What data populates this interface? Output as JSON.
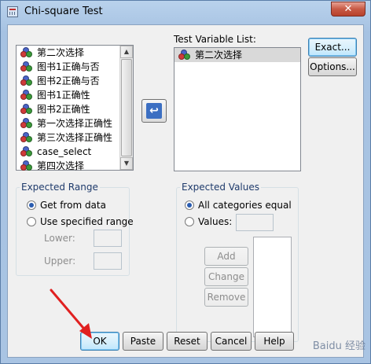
{
  "window": {
    "title": "Chi-square Test",
    "close_glyph": "✕"
  },
  "source_list": {
    "items": [
      {
        "label": "第二次选择",
        "icon": "nominal-variable-icon"
      },
      {
        "label": "图书1正确与否",
        "icon": "nominal-variable-icon"
      },
      {
        "label": "图书2正确与否",
        "icon": "nominal-variable-icon"
      },
      {
        "label": "图书1正确性",
        "icon": "nominal-variable-icon"
      },
      {
        "label": "图书2正确性",
        "icon": "nominal-variable-icon"
      },
      {
        "label": "第一次选择正确性",
        "icon": "nominal-variable-icon"
      },
      {
        "label": "第三次选择正确性",
        "icon": "nominal-variable-icon"
      },
      {
        "label": "case_select",
        "icon": "nominal-variable-icon"
      },
      {
        "label": "第四次选择",
        "icon": "nominal-variable-icon"
      }
    ]
  },
  "test_variable_list": {
    "label": "Test Variable List:",
    "items": [
      {
        "label": "第二次选择",
        "icon": "nominal-variable-icon",
        "selected": true
      }
    ]
  },
  "side_buttons": {
    "exact": "Exact...",
    "options": "Options..."
  },
  "move_button": {
    "glyph": "↩"
  },
  "expected_range": {
    "legend": "Expected Range",
    "get_from_data": {
      "label": "Get from data",
      "checked": true
    },
    "use_specified": {
      "label": "Use specified range",
      "checked": false
    },
    "lower_label": "Lower:",
    "lower_value": "",
    "upper_label": "Upper:",
    "upper_value": ""
  },
  "expected_values": {
    "legend": "Expected Values",
    "all_equal": {
      "label": "All categories equal",
      "checked": true
    },
    "values": {
      "label": "Values:",
      "checked": false
    },
    "values_input": "",
    "add_label": "Add",
    "change_label": "Change",
    "remove_label": "Remove"
  },
  "footer_buttons": {
    "ok": "OK",
    "paste": "Paste",
    "reset": "Reset",
    "cancel": "Cancel",
    "help": "Help"
  },
  "watermark_text": "Baidu 经验",
  "colors": {
    "annotation_arrow": "#e02020",
    "default_button_border": "#3c7fb1"
  }
}
